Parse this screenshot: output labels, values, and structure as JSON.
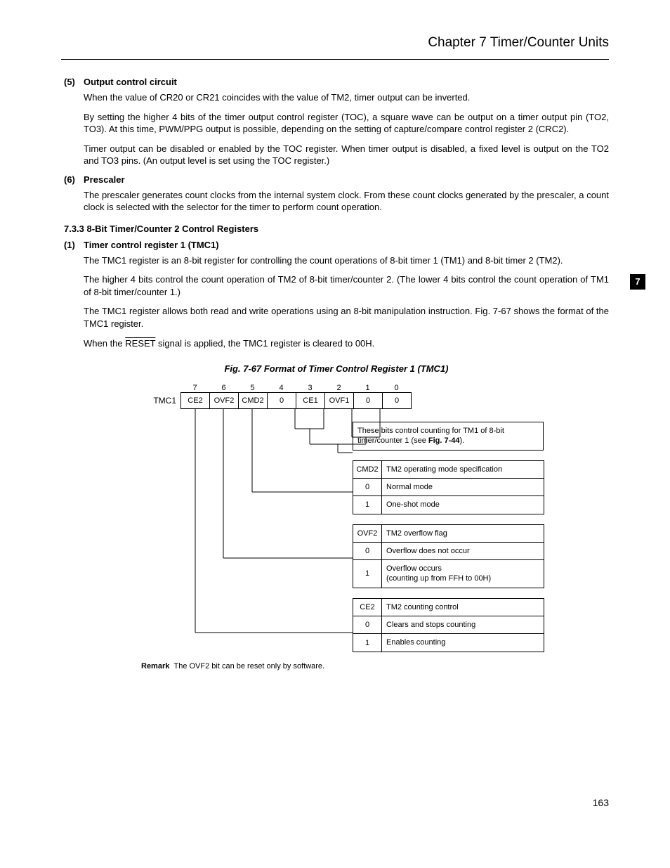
{
  "header": {
    "chapter": "Chapter 7   Timer/Counter Units"
  },
  "side_tab": "7",
  "sections": {
    "s5": {
      "num": "(5)",
      "title": "Output control circuit",
      "p1": "When the value of CR20 or CR21 coincides with the value of TM2, timer output can be inverted.",
      "p2": "By setting the higher 4 bits of the timer output control register (TOC), a square wave can be output on a timer output pin (TO2, TO3).  At this time, PWM/PPG output is possible, depending on the setting of capture/compare control register 2 (CRC2).",
      "p3": "Timer output can be disabled or enabled by the TOC register.  When timer output is disabled, a fixed level is output on the TO2 and TO3 pins.  (An output level is set using the TOC register.)"
    },
    "s6": {
      "num": "(6)",
      "title": "Prescaler",
      "p1": "The prescaler generates count clocks from the internal system clock.  From these count clocks generated by the prescaler, a count clock is selected with the selector for the timer to perform count operation."
    },
    "sub733": "7.3.3  8-Bit Timer/Counter 2 Control Registers",
    "s1": {
      "num": "(1)",
      "title": "Timer control register 1 (TMC1)",
      "p1": "The TMC1 register is an 8-bit register for controlling the count operations of 8-bit timer 1 (TM1) and 8-bit timer 2 (TM2).",
      "p2": "The higher 4 bits control the count operation of TM2 of 8-bit timer/counter 2.  (The lower 4 bits control the count operation of TM1 of 8-bit timer/counter 1.)",
      "p3": "The TMC1 register allows both read and write operations using an 8-bit manipulation instruction.  Fig. 7-67 shows the format of the TMC1 register.",
      "p4a": "When the ",
      "p4b": "RESET",
      "p4c": " signal is applied, the TMC1 register is cleared to 00H."
    }
  },
  "figure": {
    "title": "Fig. 7-67  Format of Timer Control Register 1 (TMC1)",
    "reg_name": "TMC1",
    "bit_numbers": [
      "7",
      "6",
      "5",
      "4",
      "3",
      "2",
      "1",
      "0"
    ],
    "bits": [
      "CE2",
      "OVF2",
      "CMD2",
      "0",
      "CE1",
      "OVF1",
      "0",
      "0"
    ],
    "note_low": {
      "text_a": "These bits control counting for TM1 of 8-bit timer/counter 1 (see ",
      "bold": "Fig. 7-44",
      "text_b": ")."
    },
    "groups": [
      {
        "head_key": "CMD2",
        "head_val": "TM2 operating mode specification",
        "rows": [
          {
            "k": "0",
            "v": "Normal mode"
          },
          {
            "k": "1",
            "v": "One-shot mode"
          }
        ]
      },
      {
        "head_key": "OVF2",
        "head_val": "TM2 overflow flag",
        "rows": [
          {
            "k": "0",
            "v": "Overflow does not occur"
          },
          {
            "k": "1",
            "v": "Overflow occurs\n(counting up from FFH to 00H)"
          }
        ]
      },
      {
        "head_key": "CE2",
        "head_val": "TM2 counting control",
        "rows": [
          {
            "k": "0",
            "v": "Clears and stops counting"
          },
          {
            "k": "1",
            "v": "Enables counting"
          }
        ]
      }
    ],
    "remark_label": "Remark",
    "remark_text": "The OVF2 bit can be reset only by software."
  },
  "page_number": "163"
}
